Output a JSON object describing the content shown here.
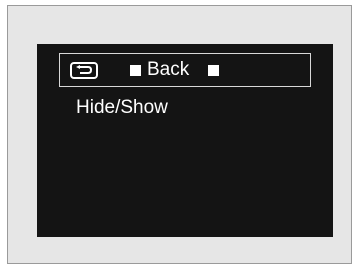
{
  "screen": {
    "back_row": {
      "icon": "back-arrow-icon",
      "label": "Back"
    },
    "items": [
      {
        "label": "Hide/Show"
      }
    ]
  },
  "colors": {
    "screen_background": "#141414",
    "text": "#ffffff",
    "outer_panel": "#e6e6e6"
  }
}
